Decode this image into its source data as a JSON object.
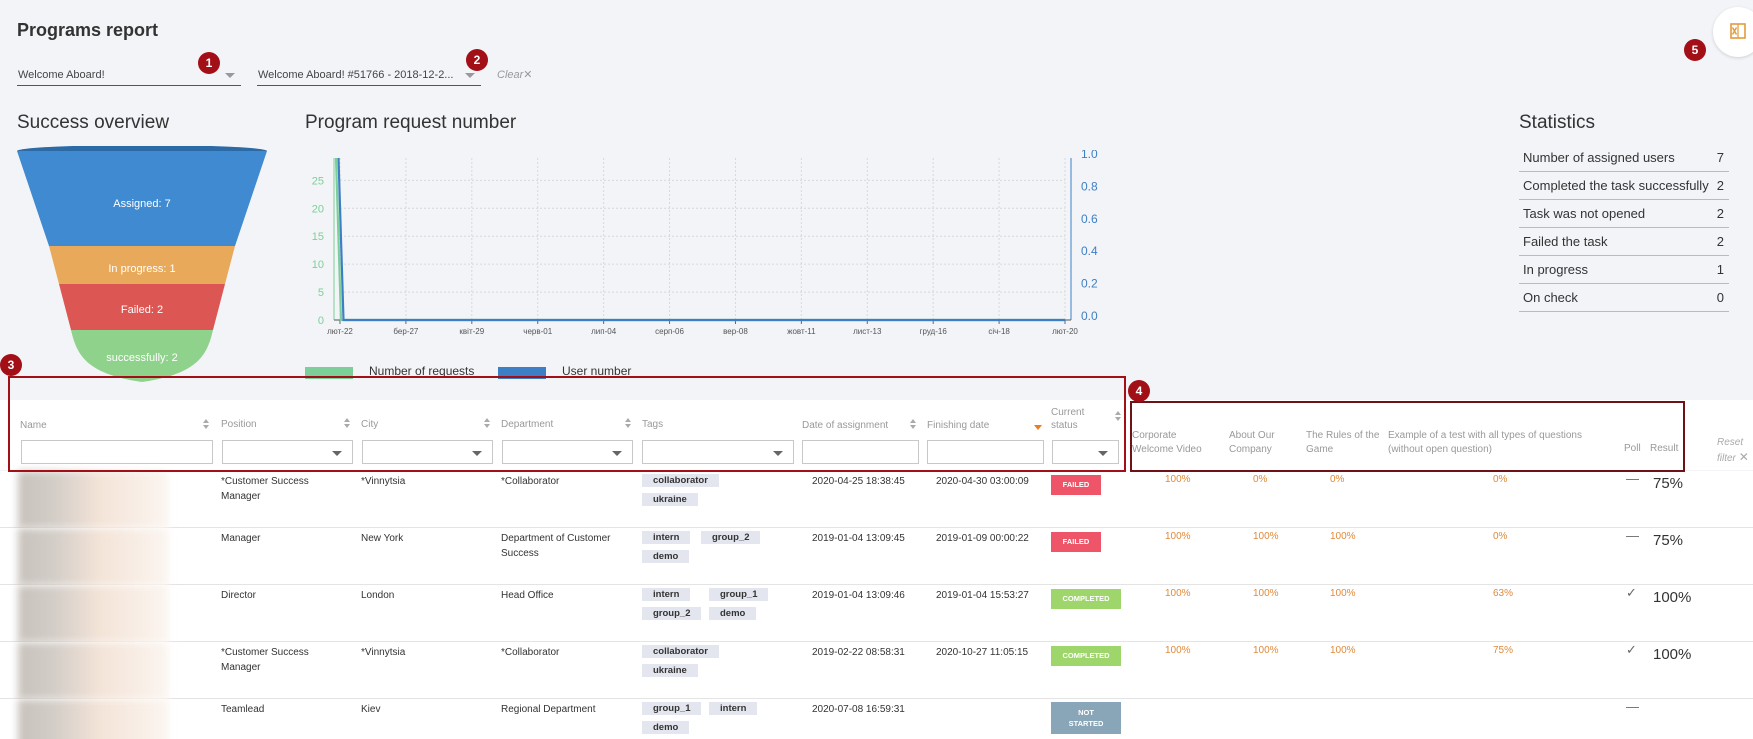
{
  "page": {
    "title": "Programs report"
  },
  "filters": {
    "program": "Welcome Aboard!",
    "request": "Welcome Aboard! #51766 - 2018-12-2...",
    "clear_label": "Clear",
    "badge1": "1",
    "badge2": "2"
  },
  "export": {
    "badge": "5",
    "icon": "excel-icon"
  },
  "sections": {
    "success": "Success overview",
    "requests": "Program request number",
    "stats": "Statistics"
  },
  "funnel": [
    {
      "label": "Assigned: 7",
      "color": "#3f8ad0"
    },
    {
      "label": "In progress: 1",
      "color": "#e8a95a"
    },
    {
      "label": "Failed: 2",
      "color": "#dc5653"
    },
    {
      "label": "successfully: 2",
      "color": "#8fd28c"
    }
  ],
  "chart_data": {
    "type": "line",
    "title": "Program request number",
    "x": [
      "лют-22",
      "бер-27",
      "квіт-29",
      "черв-01",
      "лип-04",
      "серп-06",
      "вер-08",
      "жовт-11",
      "лист-13",
      "груд-16",
      "січ-18",
      "лют-20"
    ],
    "ylim_left": [
      0,
      29
    ],
    "yticks_left": [
      0,
      5,
      10,
      15,
      20,
      25
    ],
    "ylim_right": [
      0,
      1
    ],
    "yticks_right": [
      "0.0",
      "0.2",
      "0.4",
      "0.6",
      "0.8",
      "1.0"
    ],
    "series": [
      {
        "name": "Number of requests",
        "color": "#7ccf98",
        "values": [
          29,
          0,
          0,
          0,
          0,
          0,
          0,
          0,
          0,
          0,
          0,
          0
        ]
      },
      {
        "name": "User number",
        "color": "#3d7fc4",
        "values": [
          29,
          0,
          0,
          0,
          0,
          0,
          0,
          0,
          0,
          0,
          0,
          0
        ]
      }
    ],
    "grid": true,
    "legend": "bottom-left"
  },
  "stats": [
    {
      "label": "Number of assigned users",
      "value": "7"
    },
    {
      "label": "Completed the task successfully",
      "value": "2"
    },
    {
      "label": "Task was not opened",
      "value": "2"
    },
    {
      "label": "Failed the task",
      "value": "2"
    },
    {
      "label": "In progress",
      "value": "1"
    },
    {
      "label": "On check",
      "value": "0"
    }
  ],
  "annotations": {
    "b3": "3",
    "b4": "4"
  },
  "table": {
    "headers": {
      "name": "Name",
      "position": "Position",
      "city": "City",
      "department": "Department",
      "tags": "Tags",
      "date_assign": "Date of assignment",
      "finish": "Finishing date",
      "status_1": "Current",
      "status_2": "status",
      "t1_1": "Corporate",
      "t1_2": "Welcome Video",
      "t2_1": "About Our",
      "t2_2": "Company",
      "t3_1": "The Rules of the",
      "t3_2": "Game",
      "t4_1": "Example of a test with all types of questions",
      "t4_2": "(without open question)",
      "poll": "Poll",
      "result": "Result",
      "reset_1": "Reset",
      "reset_2": "filter"
    },
    "rows": [
      {
        "position_1": "*Customer Success",
        "position_2": "Manager",
        "city": "*Vinnytsia",
        "department_1": "*Collaborator",
        "department_2": "",
        "tags": [
          "collaborator",
          "ukraine"
        ],
        "date_assign": "2020-04-25 18:38:45",
        "finish": "2020-04-30 03:00:09",
        "status": "FAILED",
        "status_2": "",
        "t1": "100%",
        "t2": "0%",
        "t3": "0%",
        "t4": "0%",
        "poll": "—",
        "result": "75%"
      },
      {
        "position_1": "Manager",
        "position_2": "",
        "city": "New York",
        "department_1": "Department of Customer",
        "department_2": "Success",
        "tags": [
          "intern",
          "group_2",
          "demo"
        ],
        "date_assign": "2019-01-04 13:09:45",
        "finish": "2019-01-09 00:00:22",
        "status": "FAILED",
        "status_2": "",
        "t1": "100%",
        "t2": "100%",
        "t3": "100%",
        "t4": "0%",
        "poll": "—",
        "result": "75%"
      },
      {
        "position_1": "Director",
        "position_2": "",
        "city": "London",
        "department_1": "Head Office",
        "department_2": "",
        "tags": [
          "intern",
          "group_1",
          "group_2",
          "demo"
        ],
        "date_assign": "2019-01-04 13:09:46",
        "finish": "2019-01-04 15:53:27",
        "status": "COMPLETED",
        "status_2": "",
        "t1": "100%",
        "t2": "100%",
        "t3": "100%",
        "t4": "63%",
        "poll": "✓",
        "result": "100%"
      },
      {
        "position_1": "*Customer Success",
        "position_2": "Manager",
        "city": "*Vinnytsia",
        "department_1": "*Collaborator",
        "department_2": "",
        "tags": [
          "collaborator",
          "ukraine"
        ],
        "date_assign": "2019-02-22 08:58:31",
        "finish": "2020-10-27 11:05:15",
        "status": "COMPLETED",
        "status_2": "",
        "t1": "100%",
        "t2": "100%",
        "t3": "100%",
        "t4": "75%",
        "poll": "✓",
        "result": "100%"
      },
      {
        "position_1": "Teamlead",
        "position_2": "",
        "city": "Kiev",
        "department_1": "Regional Department",
        "department_2": "",
        "tags": [
          "group_1",
          "intern",
          "demo"
        ],
        "date_assign": "2020-07-08 16:59:31",
        "finish": "",
        "status": "NOT",
        "status_2": "STARTED",
        "t1": "",
        "t2": "",
        "t3": "",
        "t4": "",
        "poll": "—",
        "result": ""
      }
    ]
  }
}
